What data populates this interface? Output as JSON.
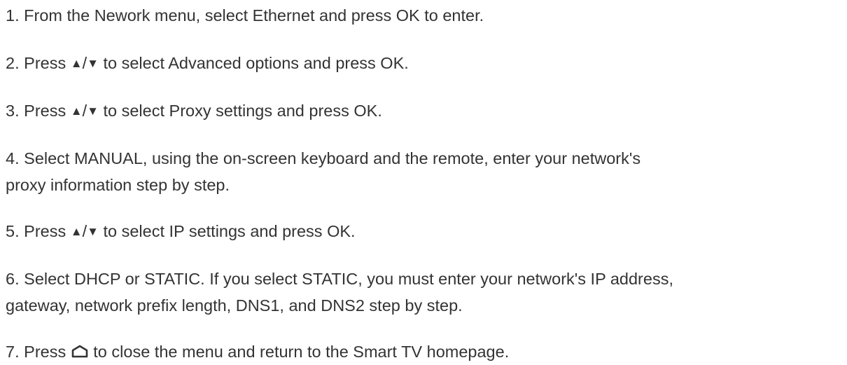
{
  "steps": [
    {
      "number": "1.",
      "text": "From the Nework menu, select Ethernet and press OK to enter."
    },
    {
      "number": "2.",
      "pre": "Press",
      "up": "▲",
      "slash": "/",
      "down": "▼",
      "post": "to select Advanced options and press OK."
    },
    {
      "number": "3.",
      "pre": "Press",
      "up": "▲",
      "slash": "/",
      "down": "▼",
      "post": "to select Proxy settings and press OK."
    },
    {
      "number": "4.",
      "line1": "Select MANUAL, using the on-screen keyboard and the remote, enter your network's",
      "line2": "proxy information step by step."
    },
    {
      "number": "5.",
      "pre": "Press",
      "up": "▲",
      "slash": "/",
      "down": "▼",
      "post": "to select IP settings and press OK."
    },
    {
      "number": "6.",
      "line1": "Select DHCP or STATIC. If you select STATIC, you must enter your network's IP address,",
      "line2": "gateway, network prefix length, DNS1, and DNS2 step by step."
    },
    {
      "number": "7.",
      "pre": "Press",
      "icon": "home-icon",
      "post": "to close the menu and return to the Smart TV homepage."
    }
  ]
}
